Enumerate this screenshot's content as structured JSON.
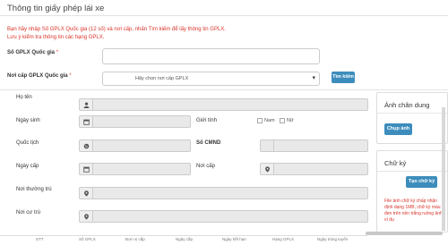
{
  "title": "Thông tin giấy phép lái xe",
  "notes": {
    "line1": "Bạn hãy nhập Số GPLX Quốc gia (12 số) và nơi cấp, nhấn Tìm kiếm để lấy thông tin GPLX.",
    "line2": "Lưu ý kiểm tra thông tin các hạng GPLX."
  },
  "search": {
    "gplx_label": "Số GPLX Quốc gia",
    "gplx_value": "",
    "issuer_label": "Nơi cấp GPLX Quốc gia",
    "issuer_selected": "Hãy chọn nơi cấp GPLX",
    "required_mark": "*",
    "search_button": "Tìm kiếm"
  },
  "form": {
    "ho_ten": "Họ tên",
    "ngay_sinh": "Ngày sinh",
    "gioi_tinh": "Giới tính",
    "nam": "Nam",
    "nu": "Nữ",
    "quoc_tich": "Quốc tịch",
    "so_cmnd": "Số CMND",
    "ngay_cap": "Ngày cấp",
    "noi_cap": "Nơi cấp",
    "noi_thuong_tru": "Nơi thường trú",
    "noi_cu_tru": "Nơi cư trú"
  },
  "photo_panel": {
    "title": "Ảnh chân dung",
    "button": "Chụp ảnh"
  },
  "signature_panel": {
    "title": "Chữ ký",
    "button": "Tạo chữ ký",
    "note": "File ảnh chữ ký chấp nhận định dạng 1MB, chữ ký màu đen trên nền trắng ruồng ảnh ví dụ"
  },
  "table_headers": [
    "STT",
    "Số GPLX",
    "Đơn vị cấp",
    "Ngày cấp",
    "Ngày hết hạn",
    "Hạng GPLX",
    "Ngày trúng tuyển"
  ],
  "colors": {
    "accent": "#3c8dbc",
    "required": "#d9342b"
  },
  "icons": {
    "name": "user-icon",
    "dob": "calendar-icon",
    "nationality": "globe-icon",
    "place": "location-icon"
  }
}
